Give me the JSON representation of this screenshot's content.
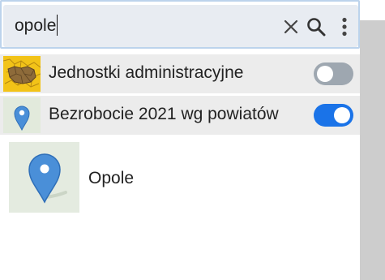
{
  "search": {
    "value": "opole",
    "clear_icon": "close-icon",
    "search_icon": "search-icon",
    "menu_icon": "more-vertical-icon"
  },
  "layers": [
    {
      "label": "Jednostki administracyjne",
      "icon": "map-regions-thumbnail",
      "enabled": false
    },
    {
      "label": "Bezrobocie 2021 wg powiatów",
      "icon": "map-pin-thumbnail",
      "enabled": true
    }
  ],
  "results": [
    {
      "label": "Opole",
      "icon": "map-pin-thumbnail"
    }
  ],
  "colors": {
    "accent": "#1a73e8",
    "pin": "#4a8fd8",
    "toggle_off": "#9ea7b0",
    "row_bg": "#ececec"
  }
}
